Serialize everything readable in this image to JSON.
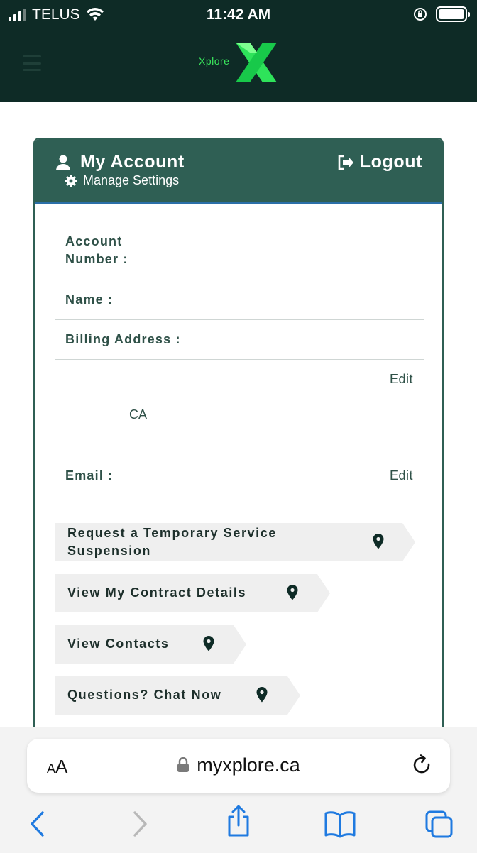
{
  "status_bar": {
    "carrier": "TELUS",
    "time": "11:42 AM"
  },
  "header": {
    "logo_text": "Xplore",
    "menu_icon": "hamburger-icon"
  },
  "account_card": {
    "title": "My Account",
    "manage_settings": "Manage Settings",
    "logout": "Logout",
    "fields": {
      "account_number_line1": "Account",
      "account_number_line2": "Number :",
      "name": "Name :",
      "billing_address": "Billing Address :",
      "address_edit": "Edit",
      "country": "CA",
      "email": "Email :",
      "email_edit": "Edit"
    },
    "actions": [
      {
        "label_line1": "Request a Temporary Service",
        "label_line2": "Suspension"
      },
      {
        "label": "View My Contract Details"
      },
      {
        "label": "View Contacts"
      },
      {
        "label": "Questions? Chat Now"
      }
    ]
  },
  "browser": {
    "text_size": "AA",
    "url": "myxplore.ca"
  },
  "colors": {
    "header_bg": "#0e2b26",
    "card_header_bg": "#2f5f54",
    "accent_green": "#39e65c",
    "text_green": "#2f5148",
    "ios_blue": "#1f7ae0"
  }
}
